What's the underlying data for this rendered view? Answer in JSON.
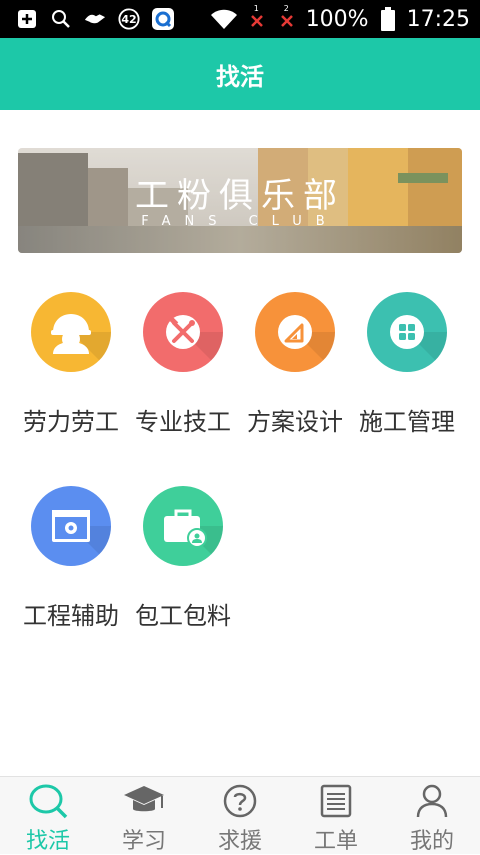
{
  "status_bar": {
    "notif_count": "42",
    "sim1": "1",
    "sim2": "2",
    "battery": "100%",
    "time": "17:25"
  },
  "header": {
    "title": "找活"
  },
  "banner": {
    "title": "工粉俱乐部",
    "subtitle": "FANS CLUB"
  },
  "categories": [
    {
      "label": "劳力劳工",
      "color": "#f7b733",
      "icon": "worker-icon"
    },
    {
      "label": "专业技工",
      "color": "#f26c6c",
      "icon": "tools-icon"
    },
    {
      "label": "方案设计",
      "color": "#f7923a",
      "icon": "ruler-icon"
    },
    {
      "label": "施工管理",
      "color": "#3cc0b0",
      "icon": "grid-icon"
    },
    {
      "label": "工程辅助",
      "color": "#5b8ef0",
      "icon": "settings-window-icon"
    },
    {
      "label": "包工包料",
      "color": "#3fcf9a",
      "icon": "toolbox-icon"
    }
  ],
  "tabs": [
    {
      "label": "找活",
      "icon": "search-icon",
      "active": true
    },
    {
      "label": "学习",
      "icon": "graduation-cap-icon",
      "active": false
    },
    {
      "label": "求援",
      "icon": "help-icon",
      "active": false
    },
    {
      "label": "工单",
      "icon": "list-icon",
      "active": false
    },
    {
      "label": "我的",
      "icon": "user-icon",
      "active": false
    }
  ],
  "colors": {
    "accent": "#1dc8a8"
  }
}
